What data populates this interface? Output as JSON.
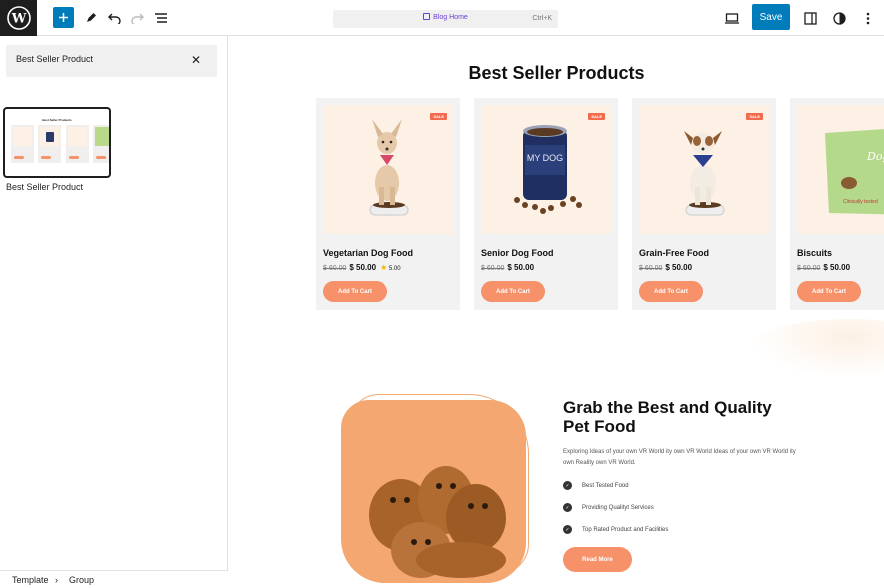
{
  "toolbar": {
    "command_title": "Blog Home",
    "command_shortcut": "Ctrl+K",
    "save_label": "Save"
  },
  "sidebar": {
    "search_value": "Best Seller Product",
    "pattern_label": "Best Seller Product",
    "pattern_preview_title": "Best Seller Products"
  },
  "breadcrumb": [
    "Template",
    "Group"
  ],
  "canvas": {
    "section_title": "Best Seller Products",
    "products": [
      {
        "name": "Vegetarian Dog Food",
        "old_price": "$ 60.00",
        "new_price": "$ 50.00",
        "rating": "5.00",
        "sale": "SALE",
        "button": "Add To Cart"
      },
      {
        "name": "Senior Dog Food",
        "old_price": "$ 60.00",
        "new_price": "$ 50.00",
        "sale": "SALE",
        "button": "Add To Cart",
        "can_label": "MY DOG"
      },
      {
        "name": "Grain-Free Food",
        "old_price": "$ 60.00",
        "new_price": "$ 50.00",
        "sale": "SALE",
        "button": "Add To Cart"
      },
      {
        "name": "Biscuits",
        "old_price": "$ 60.00",
        "new_price": "$ 50.00",
        "button": "Add To Cart",
        "bag_label": "Dog Food",
        "bag_sub": "Clinically tested"
      }
    ],
    "feature_section": {
      "title": "Grab the Best and Quality Pet Food",
      "description": "Exploring Ideas of your own VR World ity own VR World Ideas of your own VR World ity own Reality own VR World.",
      "features": [
        "Best Tested Food",
        "Providing Qualityt Services",
        "Top Rated Product and Facilities"
      ],
      "button": "Read More"
    }
  },
  "colors": {
    "accent": "#007cba",
    "button": "#f6916a",
    "sale": "#f26b4f",
    "blob": "#f4a771"
  }
}
